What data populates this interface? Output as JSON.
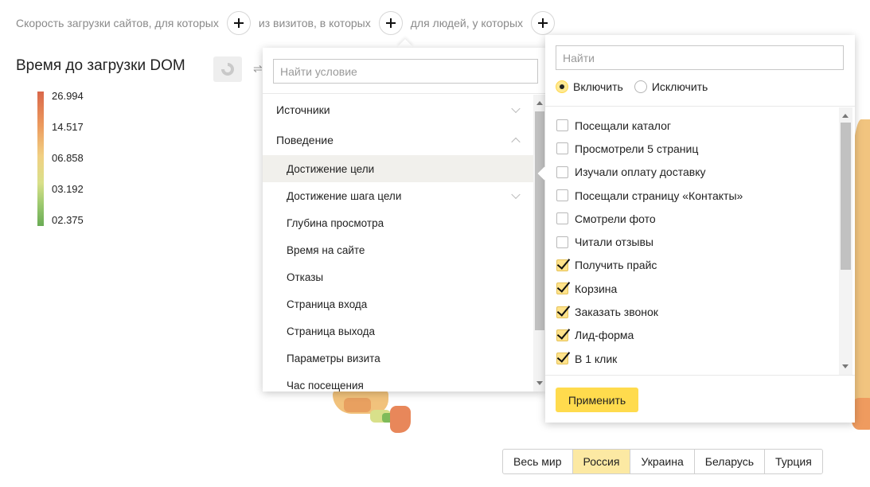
{
  "segment": {
    "part1": "Скорость загрузки сайтов, для которых",
    "part2": "из визитов, в которых",
    "part3": "для людей, у которых"
  },
  "chart": {
    "title": "Время до загрузки DOM",
    "legend_labels": [
      "26.994",
      "14.517",
      "06.858",
      "03.192",
      "02.375"
    ]
  },
  "condition_panel": {
    "search_placeholder": "Найти условие",
    "categories": [
      {
        "label": "Источники",
        "expanded": false
      },
      {
        "label": "Поведение",
        "expanded": true
      }
    ],
    "items": [
      {
        "label": "Достижение цели",
        "active": true
      },
      {
        "label": "Достижение шага цели",
        "has_children": true
      },
      {
        "label": "Глубина просмотра"
      },
      {
        "label": "Время на сайте"
      },
      {
        "label": "Отказы"
      },
      {
        "label": "Страница входа"
      },
      {
        "label": "Страница выхода"
      },
      {
        "label": "Параметры визита"
      },
      {
        "label": "Час посещения"
      }
    ]
  },
  "goal_panel": {
    "search_placeholder": "Найти",
    "include_label": "Включить",
    "exclude_label": "Исключить",
    "mode": "include",
    "options": [
      {
        "label": "Посещали каталог",
        "checked": false
      },
      {
        "label": "Просмотрели 5 страниц",
        "checked": false
      },
      {
        "label": "Изучали оплату доставку",
        "checked": false
      },
      {
        "label": "Посещали страницу «Контакты»",
        "checked": false
      },
      {
        "label": "Смотрели фото",
        "checked": false
      },
      {
        "label": "Читали отзывы",
        "checked": false
      },
      {
        "label": "Получить прайс",
        "checked": true
      },
      {
        "label": "Корзина",
        "checked": true
      },
      {
        "label": "Заказать звонок",
        "checked": true
      },
      {
        "label": "Лид-форма",
        "checked": true
      },
      {
        "label": "В 1 клик",
        "checked": true
      }
    ],
    "apply_label": "Применить"
  },
  "regions": {
    "items": [
      "Весь мир",
      "Россия",
      "Украина",
      "Беларусь",
      "Турция"
    ],
    "selected": "Россия"
  },
  "colors": {
    "accent_yellow": "#ffdb4d",
    "selected_region": "#fce9a3",
    "legend_high": "#d9674a",
    "legend_low": "#6aab55"
  }
}
